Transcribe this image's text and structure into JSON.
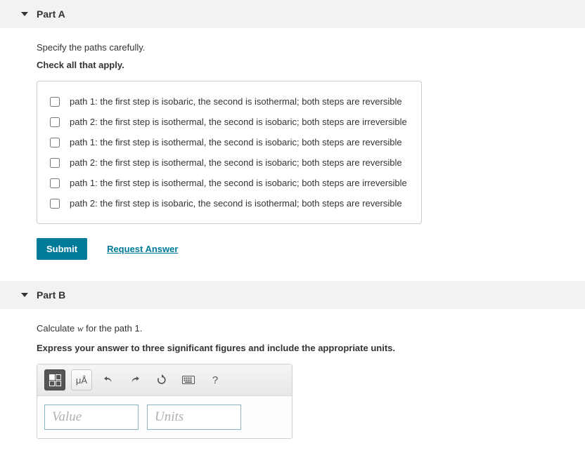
{
  "partA": {
    "title": "Part A",
    "instruction": "Specify the paths carefully.",
    "bold_instruction": "Check all that apply.",
    "options": [
      "path 1: the first step is isobaric, the second is isothermal; both steps are reversible",
      "path 2: the first step is isothermal, the second is isobaric; both steps are irreversible",
      "path 1: the first step is isothermal, the second is isobaric; both steps are reversible",
      "path 2: the first step is isothermal, the second is isobaric; both steps are reversible",
      "path 1: the first step is isothermal, the second is isobaric; both steps are irreversible",
      "path 2: the first step is isobaric, the second is isothermal; both steps are reversible"
    ],
    "submit_label": "Submit",
    "request_answer_label": "Request Answer"
  },
  "partB": {
    "title": "Part B",
    "calc_prefix": "Calculate ",
    "calc_var": "w",
    "calc_suffix": " for the path 1.",
    "bold_instruction": "Express your answer to three significant figures and include the appropriate units.",
    "toolbar": {
      "templates_icon": "templates-icon",
      "symbols_label": "μÅ",
      "undo_icon": "undo-icon",
      "redo_icon": "redo-icon",
      "reset_icon": "reset-icon",
      "keyboard_icon": "keyboard-icon",
      "help_label": "?"
    },
    "value_placeholder": "Value",
    "units_placeholder": "Units"
  }
}
